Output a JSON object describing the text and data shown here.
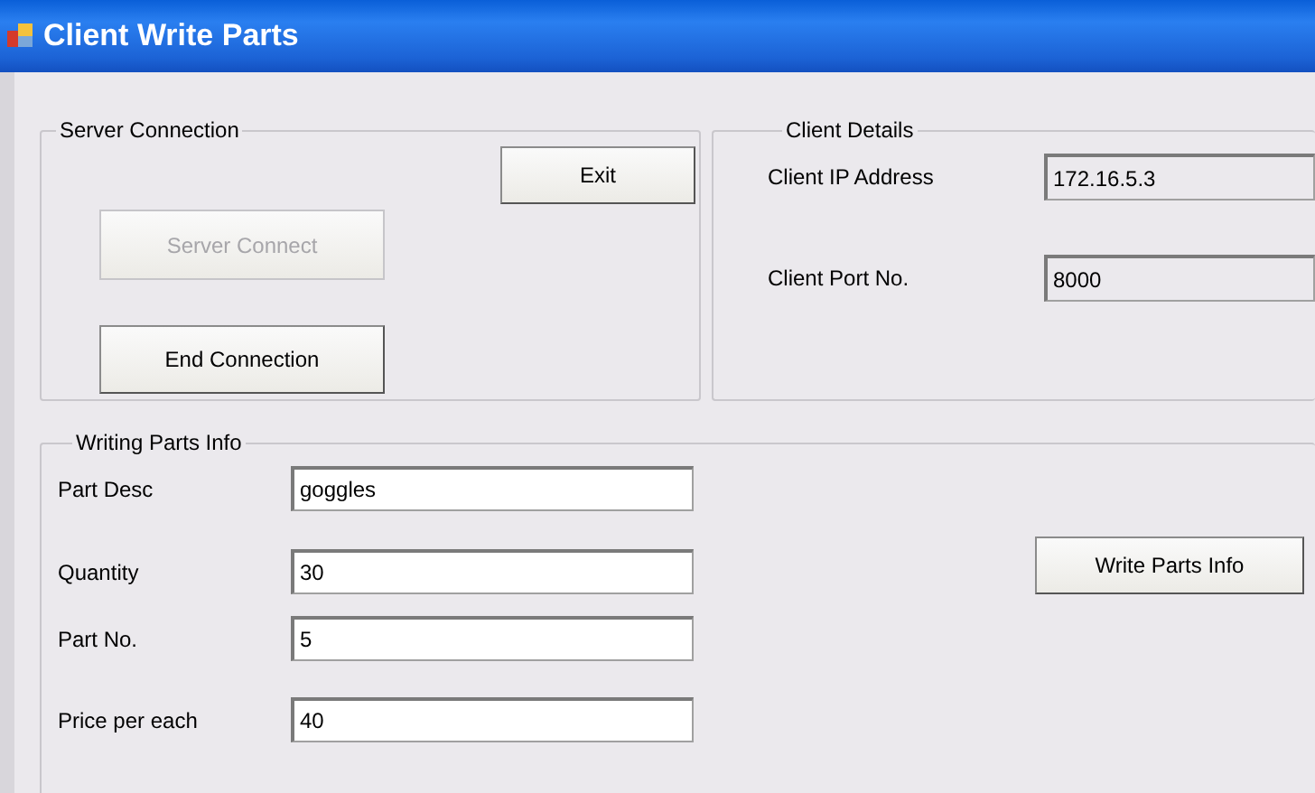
{
  "window": {
    "title": "Client Write Parts"
  },
  "server_connection": {
    "title": "Server Connection",
    "buttons": [
      {
        "label": "Exit",
        "disabled": false
      },
      {
        "label": "Server Connect",
        "disabled": true
      },
      {
        "label": "End Connection",
        "disabled": false
      }
    ]
  },
  "client_details": {
    "title": "Client Details",
    "fields": [
      {
        "label": "Client IP Address",
        "value": "172.16.5.3",
        "readonly": true
      },
      {
        "label": "Client Port No.",
        "value": "8000",
        "readonly": true
      }
    ]
  },
  "writing_parts_info": {
    "title": "Writing Parts Info",
    "fields": [
      {
        "label": "Part Desc",
        "value": "goggles",
        "readonly": false
      },
      {
        "label": "Quantity",
        "value": "30",
        "readonly": false
      },
      {
        "label": "Part No.",
        "value": "5",
        "readonly": false
      },
      {
        "label": "Price per each",
        "value": "40",
        "readonly": false
      }
    ],
    "button": {
      "label": "Write Parts Info",
      "disabled": false
    }
  }
}
